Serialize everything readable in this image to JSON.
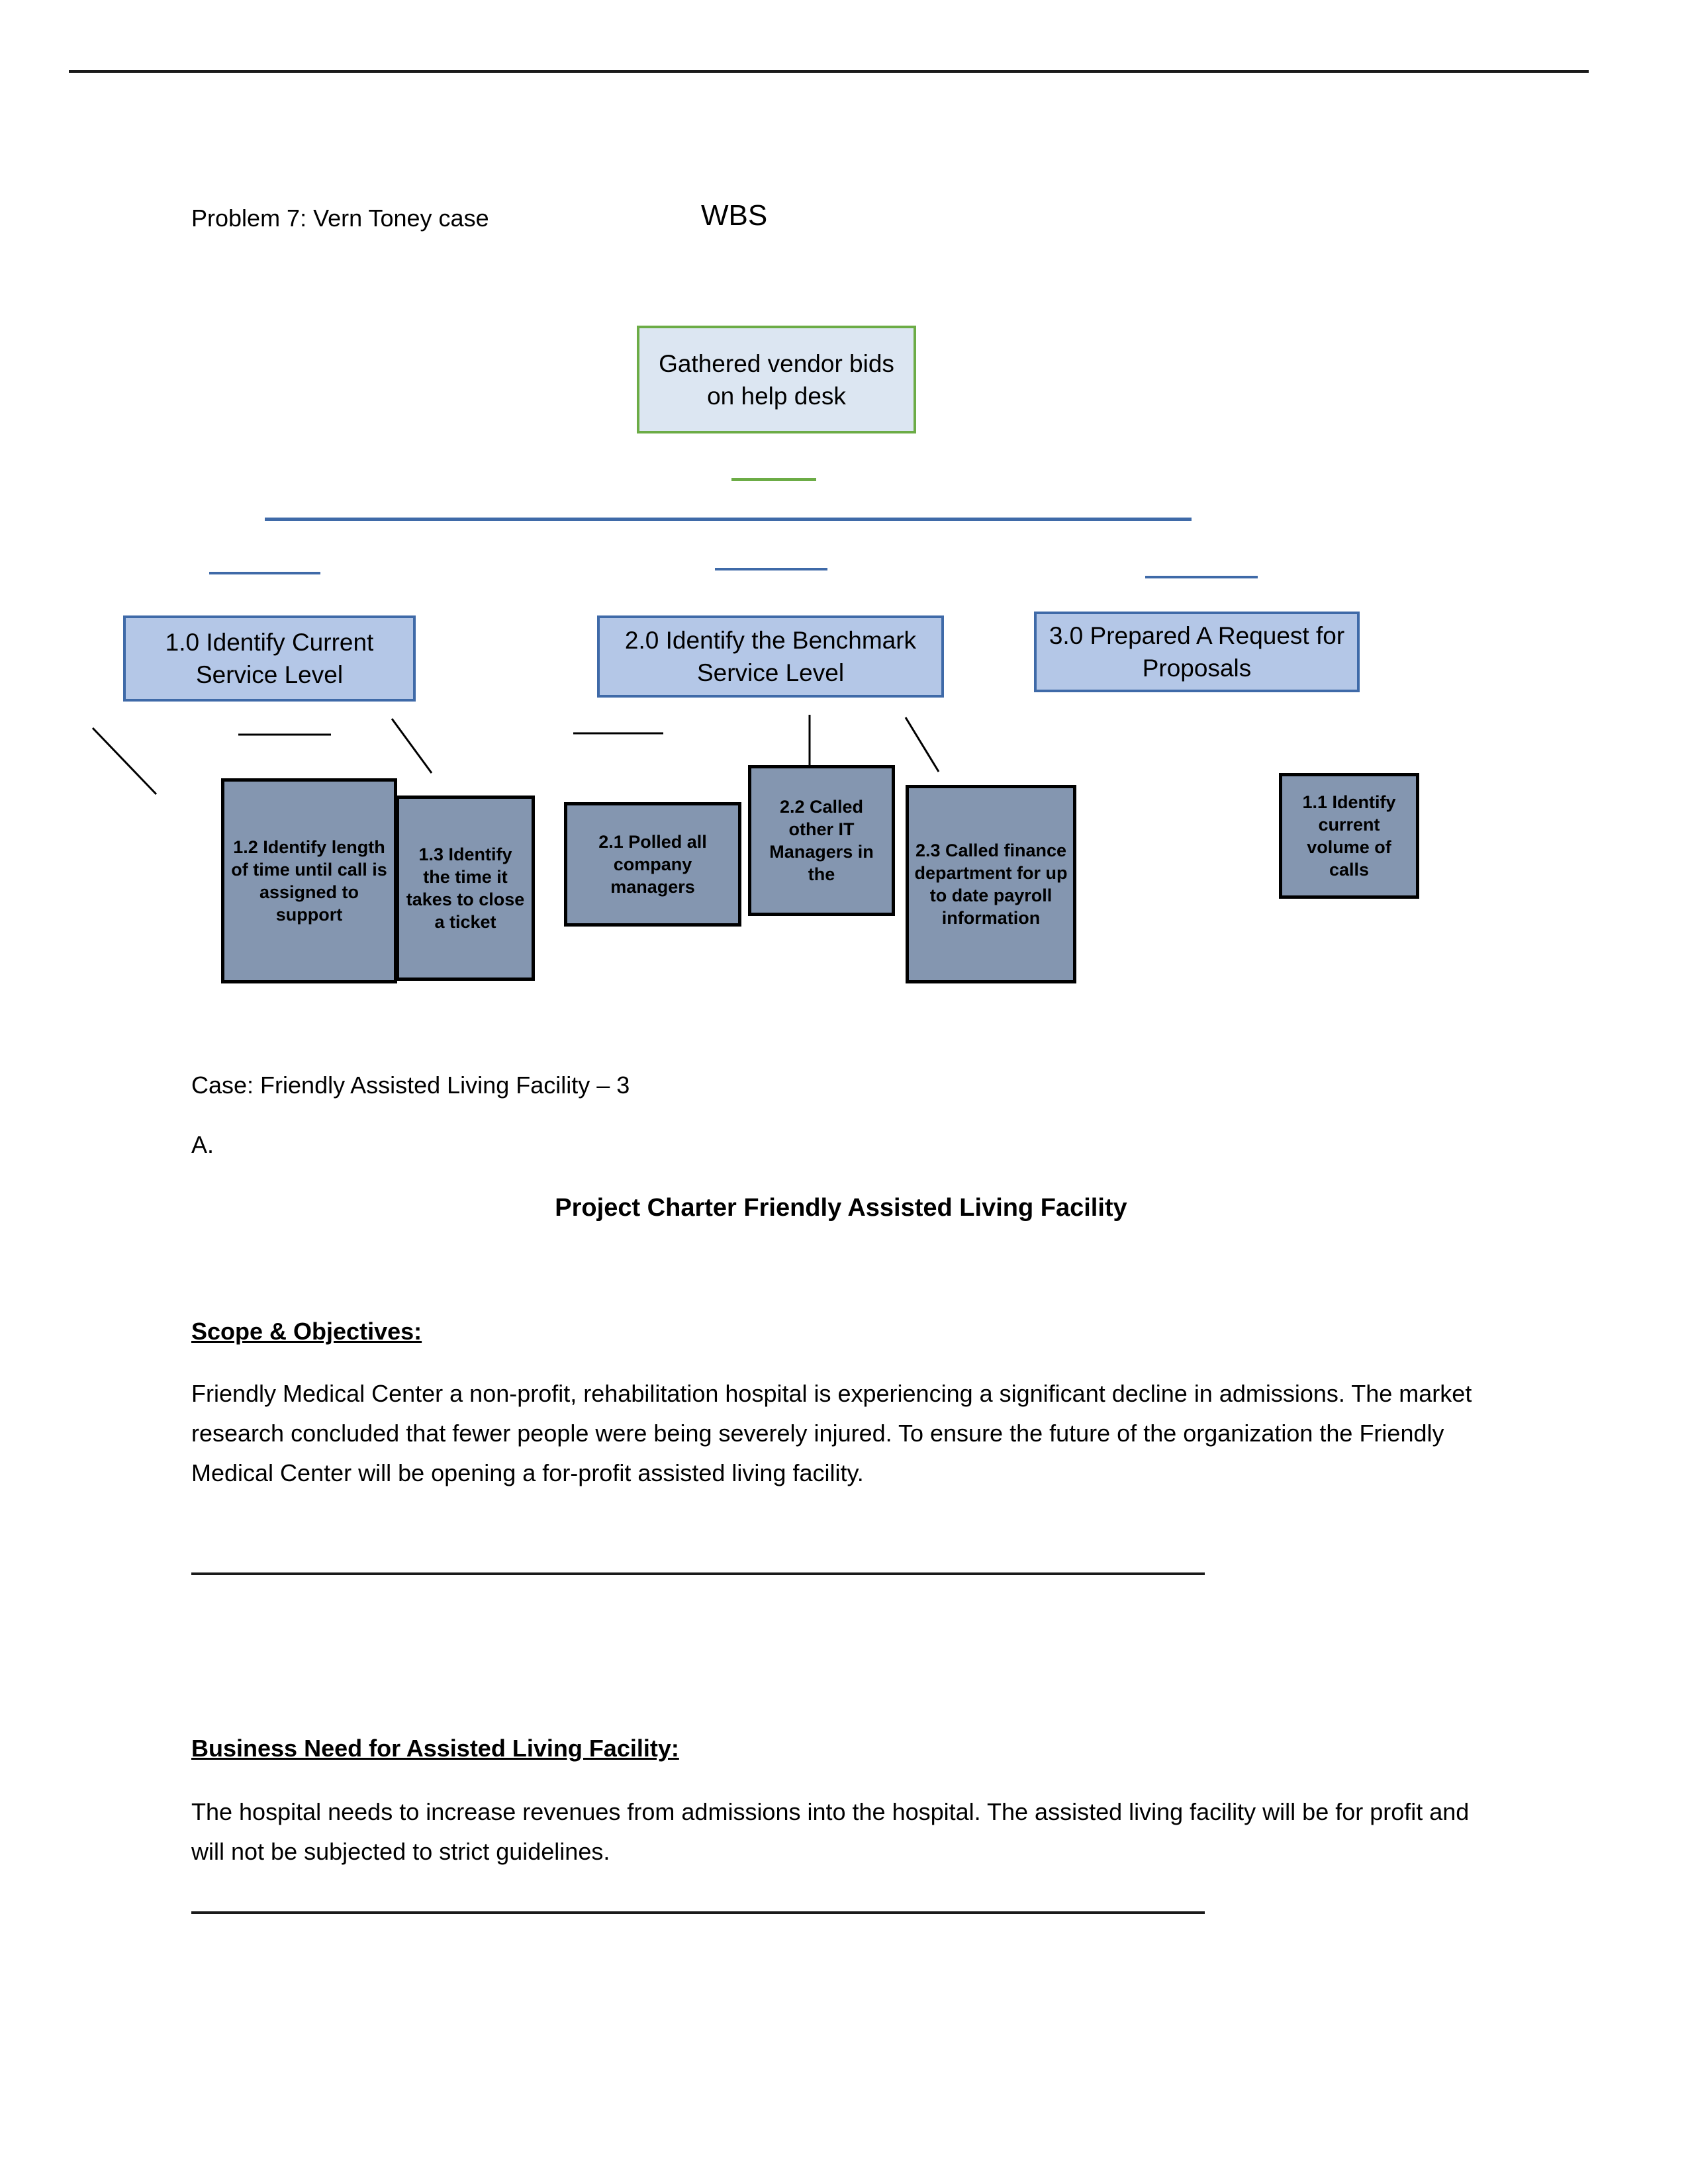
{
  "page": {
    "header_rule": true
  },
  "caption": {
    "left": "Problem 7: Vern Toney case",
    "title": "WBS"
  },
  "wbs": {
    "root": {
      "id": "0.0",
      "label": "Gathered vendor bids on help desk",
      "fill": "#DCE6F2",
      "border": "#6CAC46"
    },
    "level1": [
      {
        "id": "1.0",
        "label": "1.0 Identify Current Service Level",
        "fill": "#B4C7E7",
        "border": "#3F6AA8"
      },
      {
        "id": "2.0",
        "label": "2.0 Identify the Benchmark Service Level",
        "fill": "#B4C7E7",
        "border": "#3F6AA8"
      },
      {
        "id": "3.0",
        "label": "3.0 Prepared A Request for Proposals",
        "fill": "#B4C7E7",
        "border": "#3F6AA8"
      }
    ],
    "level2": [
      {
        "id": "1.2",
        "label": "1.2 Identify length of time until call is assigned to support",
        "fill": "#8496B0",
        "border": "#000000"
      },
      {
        "id": "1.3",
        "label": "1.3 Identify the time it takes to close a ticket",
        "fill": "#8496B0",
        "border": "#000000"
      },
      {
        "id": "2.1",
        "label": "2.1 Polled all company managers",
        "fill": "#8496B0",
        "border": "#000000"
      },
      {
        "id": "2.2",
        "label": "2.2 Called other IT Managers in the",
        "fill": "#8496B0",
        "border": "#000000"
      },
      {
        "id": "2.3",
        "label": "2.3 Called finance department for up to date payroll information",
        "fill": "#8496B0",
        "border": "#000000"
      },
      {
        "id": "1.1",
        "label": "1.1 Identify current volume of calls",
        "fill": "#8496B0",
        "border": "#000000"
      }
    ]
  },
  "doc": {
    "case_line": "Case: Friendly Assisted Living Facility – 3",
    "item_label": "A.",
    "charter_title": "Project Charter Friendly Assisted Living Facility",
    "scope_heading": "Scope & Objectives:",
    "scope_body": "Friendly Medical Center a non-profit, rehabilitation hospital is experiencing a significant decline in admissions. The market research concluded that fewer people were being severely injured. To ensure the future of the organization the Friendly Medical Center will be opening a for-profit assisted living facility.",
    "business_heading": "Business Need for Assisted Living Facility:",
    "business_body": "The hospital needs to increase revenues from admissions into the hospital. The assisted living facility will be for profit and will not be subjected to strict guidelines."
  }
}
